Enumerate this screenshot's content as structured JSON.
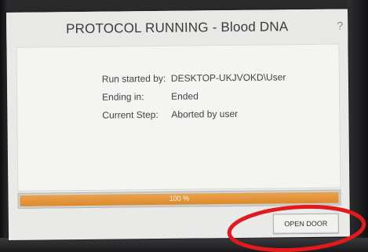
{
  "window": {
    "title": "PROTOCOL RUNNING - Blood DNA",
    "help_glyph": "?"
  },
  "run_info": [
    {
      "label": "Run started by:",
      "value": "DESKTOP-UKJVOKD\\User"
    },
    {
      "label": "Ending in:",
      "value": "Ended"
    },
    {
      "label": "Current Step:",
      "value": "Aborted by user"
    }
  ],
  "progress": {
    "percent": 100,
    "label": "100 %",
    "color": "#dc8a2c"
  },
  "buttons": {
    "open_door_label": "OPEN DOOR"
  },
  "annotation": {
    "shape": "ellipse",
    "color": "#e3191d",
    "target": "open-door-button"
  }
}
